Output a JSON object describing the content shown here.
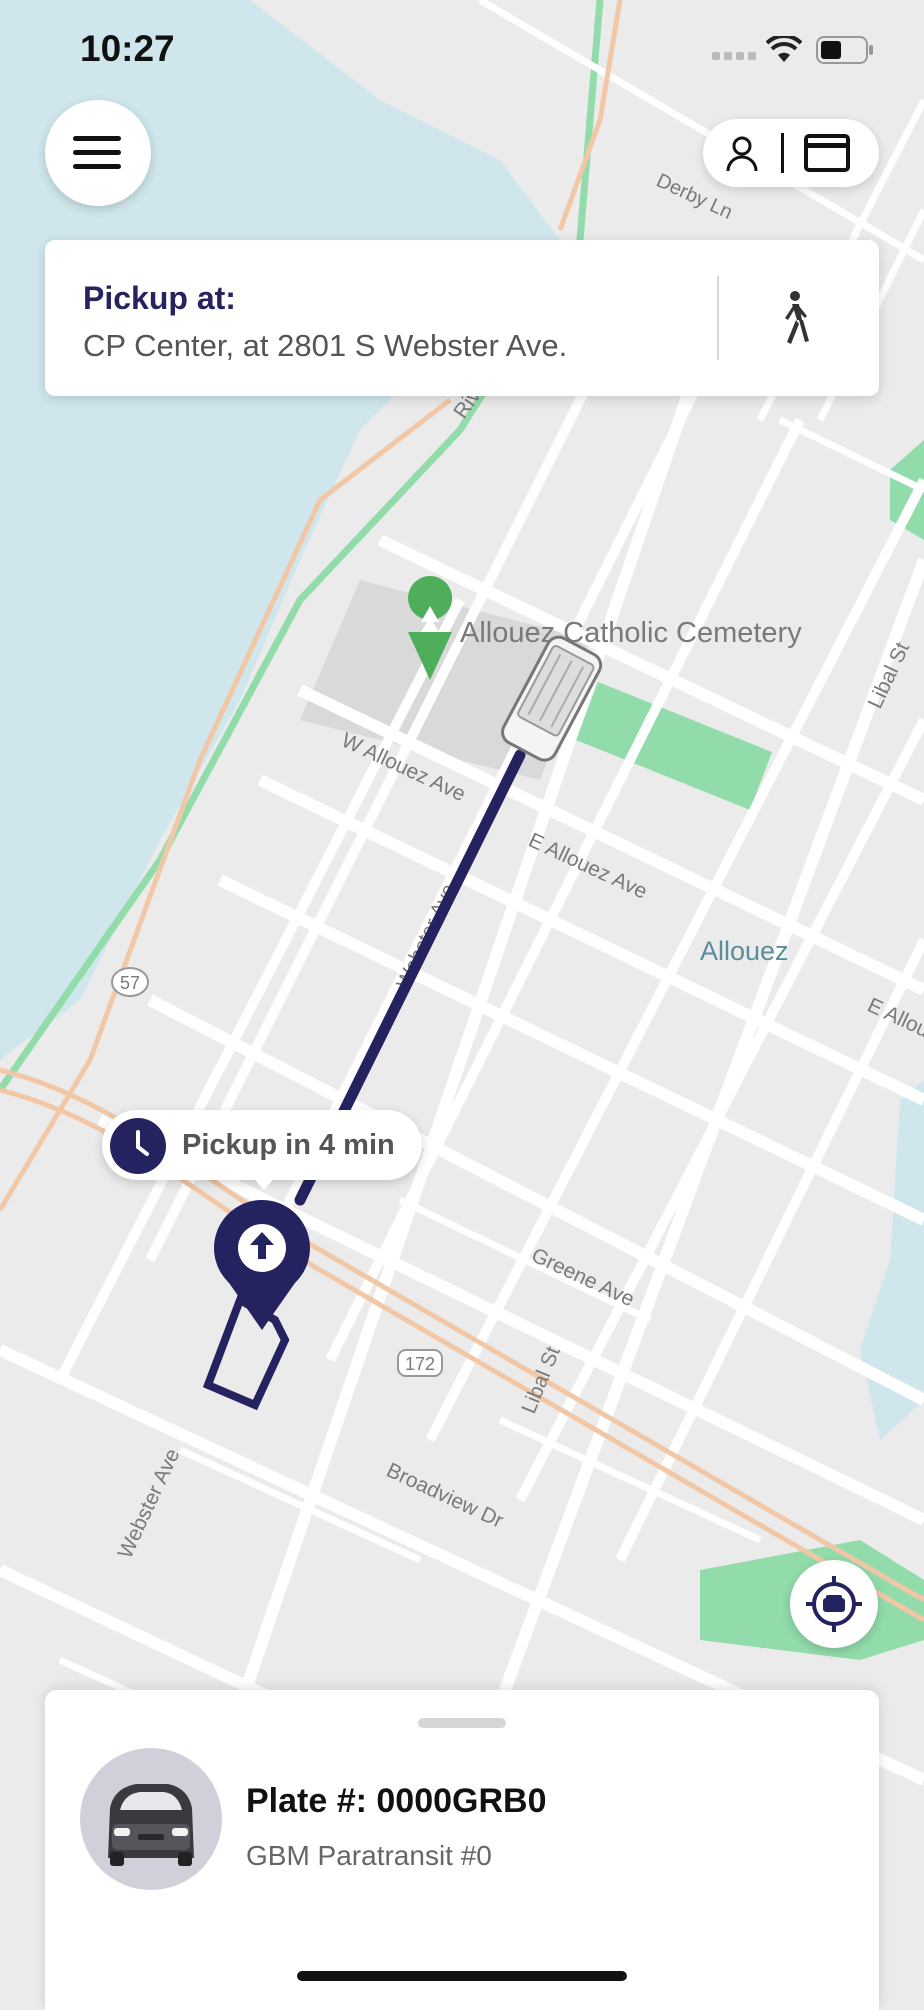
{
  "status_bar": {
    "time": "10:27"
  },
  "pickup_card": {
    "title": "Pickup at:",
    "address": "CP Center, at 2801 S Webster Ave."
  },
  "eta": {
    "label": "Pickup in 4 min"
  },
  "map": {
    "place_name": "Allouez Catholic Cemetery",
    "neighborhood": "Allouez",
    "streets": {
      "w_allouez": "W Allouez Ave",
      "e_allouez": "E Allouez Ave",
      "e_allouez_right": "E Allou",
      "webster_1": "Webster Ave",
      "webster_2": "Webster Ave",
      "libal_1": "Libal St",
      "libal_2": "Libal St",
      "greene": "Greene Ave",
      "broadview": "Broadview Dr",
      "derby": "Derby Ln",
      "river": "Riv"
    },
    "highway_shields": {
      "h57": "57",
      "h172": "172"
    }
  },
  "vehicle_sheet": {
    "plate": "Plate #: 0000GRB0",
    "vehicle_name": "GBM Paratransit #0"
  },
  "icons": {
    "menu": "hamburger-menu-icon",
    "profile": "person-icon",
    "wallet": "card-icon",
    "walk": "walking-person-icon",
    "clock": "clock-icon",
    "pickup_marker": "pickup-arrow-icon",
    "recenter": "vehicle-locate-icon",
    "cemetery": "tree-pin-icon"
  },
  "colors": {
    "route": "#25235f",
    "park": "#92dcab",
    "water": "#cfe7ec",
    "highway": "#f2c7a6",
    "road": "#ffffff",
    "map_bg": "#ebebeb"
  }
}
